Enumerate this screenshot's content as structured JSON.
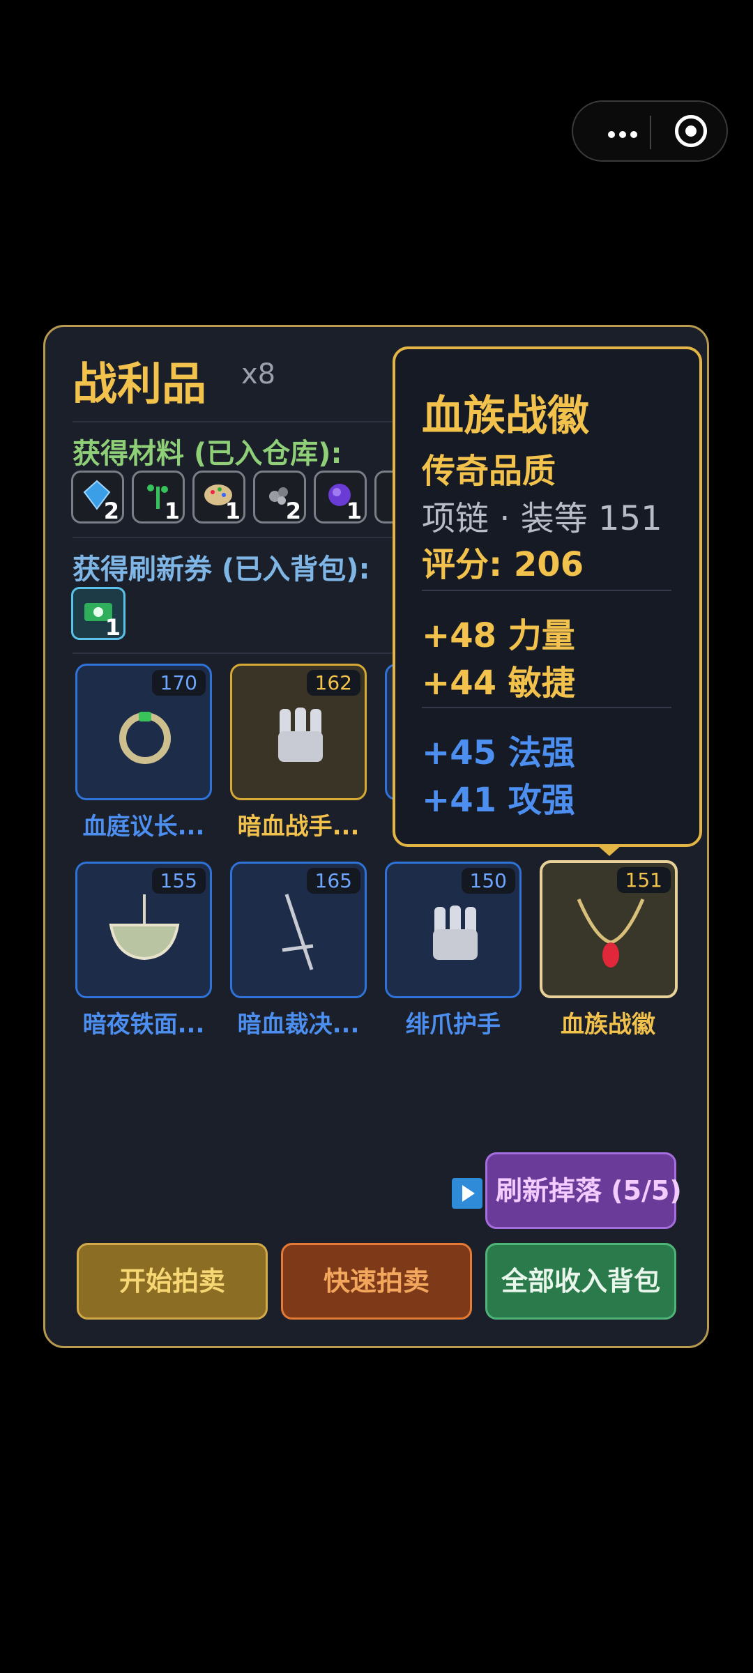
{
  "menu": {
    "more_label": "more",
    "close_label": "close"
  },
  "loot": {
    "title": "战利品",
    "count": "x8",
    "materials_label": "获得材料 (已入仓库):",
    "materials": [
      {
        "icon": "crystal-icon",
        "count": "2"
      },
      {
        "icon": "herb-icon",
        "count": "1"
      },
      {
        "icon": "palette-icon",
        "count": "1"
      },
      {
        "icon": "ore-icon",
        "count": "2"
      },
      {
        "icon": "gem-icon",
        "count": "1"
      }
    ],
    "tickets_label": "获得刷新券 (已入背包):",
    "ticket": {
      "icon": "refresh-ticket-icon",
      "count": "1"
    },
    "items": [
      {
        "name": "血庭议长...",
        "level": "170",
        "icon": "ring-icon"
      },
      {
        "name": "暗血战手...",
        "level": "162",
        "icon": "gauntlet-icon"
      },
      {
        "name": "暗夜铁面...",
        "level": "155",
        "icon": "bowl-icon"
      },
      {
        "name": "暗血裁决...",
        "level": "165",
        "icon": "sword-icon"
      },
      {
        "name": "绯爪护手",
        "level": "150",
        "icon": "gauntlet-icon"
      },
      {
        "name": "血族战徽",
        "level": "151",
        "icon": "necklace-icon"
      }
    ]
  },
  "tooltip": {
    "name": "血族战徽",
    "quality": "传奇品质",
    "type_level": "项链 · 装等 151",
    "score": "评分: 206",
    "primary_stats": [
      "+48 力量",
      "+44 敏捷"
    ],
    "secondary_stats": [
      "+45 法强",
      "+41 攻强"
    ]
  },
  "buttons": {
    "refresh": "刷新掉落 (5/5)",
    "start_auction": "开始拍卖",
    "quick_auction": "快速拍卖",
    "collect_all": "全部收入背包"
  },
  "colors": {
    "gold": "#f2c24c",
    "blue": "#4c8ff0",
    "green": "#8fcf78",
    "panel": "#1b1f2a"
  }
}
